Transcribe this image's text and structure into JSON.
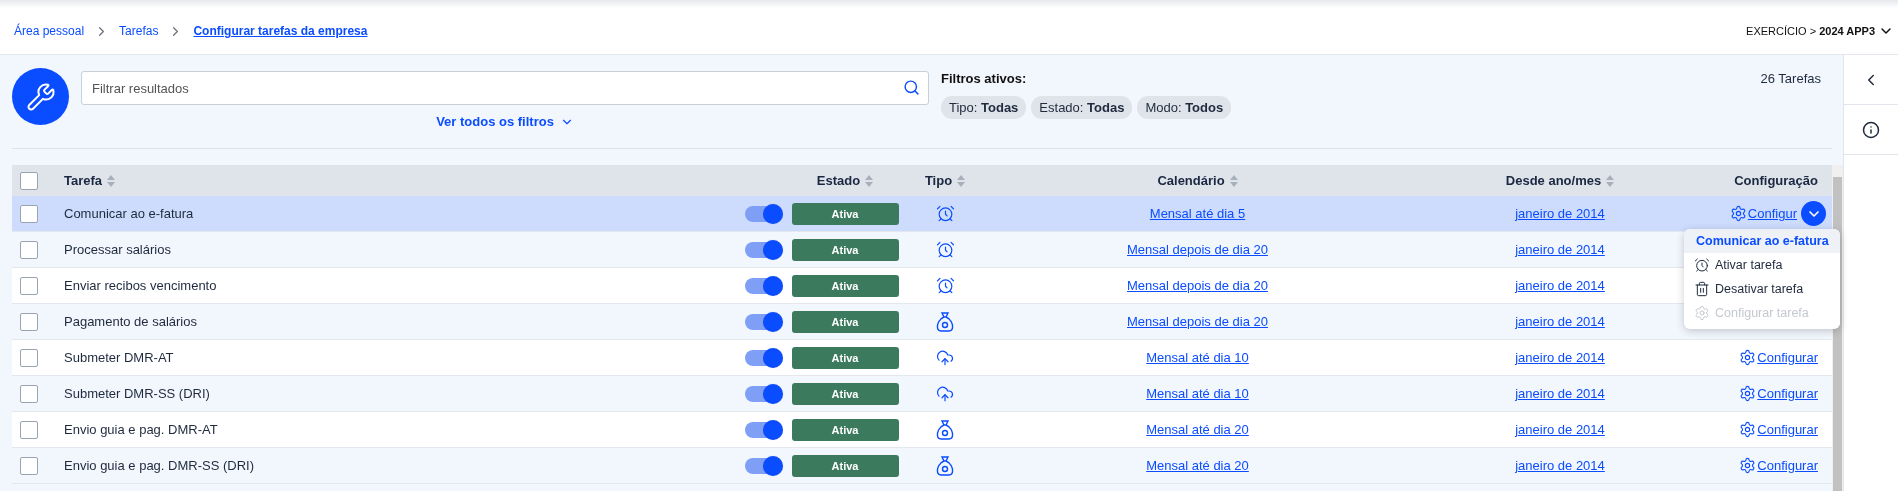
{
  "breadcrumbs": [
    {
      "label": "Área pessoal",
      "current": false
    },
    {
      "label": "Tarefas",
      "current": false
    },
    {
      "label": "Configurar tarefas da empresa",
      "current": true
    }
  ],
  "exercise": "EXERCÍCIO > **2024 APP3**",
  "search": {
    "placeholder": "Filtrar resultados"
  },
  "filters_link": "Ver todos os filtros",
  "active_filters": {
    "title": "Filtros ativos:",
    "chips": [
      "Tipo: **Todas**",
      "Estado: **Todas**",
      "Modo: **Todos**"
    ]
  },
  "count": "26 Tarefas",
  "table": {
    "all_checked": false,
    "columns": [
      "Tarefa",
      "Estado",
      "Tipo",
      "Calendário",
      "Desde ano/mes",
      "Configuração"
    ],
    "rows": [
      {
        "selected": true,
        "checked": false,
        "name": "Comunicar ao e-fatura",
        "on": true,
        "estado": "Ativa",
        "kind": "alarm",
        "calendar": "Mensal até dia 5",
        "since": "janeiro de 2014",
        "config": "Configur",
        "menu_open": true
      },
      {
        "selected": false,
        "checked": false,
        "name": "Processar salários",
        "on": true,
        "estado": "Ativa",
        "kind": "alarm",
        "calendar": "Mensal depois de dia 20",
        "since": "janeiro de 2014",
        "menu_open": false
      },
      {
        "selected": false,
        "checked": false,
        "name": "Enviar recibos vencimento",
        "on": true,
        "estado": "Ativa",
        "kind": "alarm",
        "calendar": "Mensal depois de dia 20",
        "since": "janeiro de 2014",
        "menu_open": false
      },
      {
        "selected": false,
        "checked": false,
        "name": "Pagamento de salários",
        "on": true,
        "estado": "Ativa",
        "kind": "bag",
        "calendar": "Mensal depois de dia 20",
        "since": "janeiro de 2014",
        "menu_open": false
      },
      {
        "selected": false,
        "checked": false,
        "name": "Submeter DMR-AT",
        "on": true,
        "estado": "Ativa",
        "kind": "upload",
        "calendar": "Mensal até dia 10",
        "since": "janeiro de 2014",
        "config": "Configurar",
        "menu_open": false
      },
      {
        "selected": false,
        "checked": false,
        "name": "Submeter DMR-SS (DRI)",
        "on": true,
        "estado": "Ativa",
        "kind": "upload",
        "calendar": "Mensal até dia 10",
        "since": "janeiro de 2014",
        "config": "Configurar",
        "menu_open": false
      },
      {
        "selected": false,
        "checked": false,
        "name": "Envio guia e pag. DMR-AT",
        "on": true,
        "estado": "Ativa",
        "kind": "bag",
        "calendar": "Mensal até dia 20",
        "since": "janeiro de 2014",
        "config": "Configurar",
        "menu_open": false
      },
      {
        "selected": false,
        "checked": false,
        "name": "Envio guia e pag. DMR-SS (DRI)",
        "on": true,
        "estado": "Ativa",
        "kind": "bag",
        "calendar": "Mensal até dia 20",
        "since": "janeiro de 2014",
        "config": "Configurar",
        "menu_open": false
      }
    ]
  },
  "menu": {
    "title": "Comunicar ao e-fatura",
    "items": [
      {
        "label": "Ativar tarefa",
        "kind": "alarm",
        "disabled": false
      },
      {
        "label": "Desativar tarefa",
        "kind": "trash",
        "disabled": false
      },
      {
        "label": "Configurar tarefa",
        "kind": "gear",
        "disabled": true
      }
    ]
  }
}
